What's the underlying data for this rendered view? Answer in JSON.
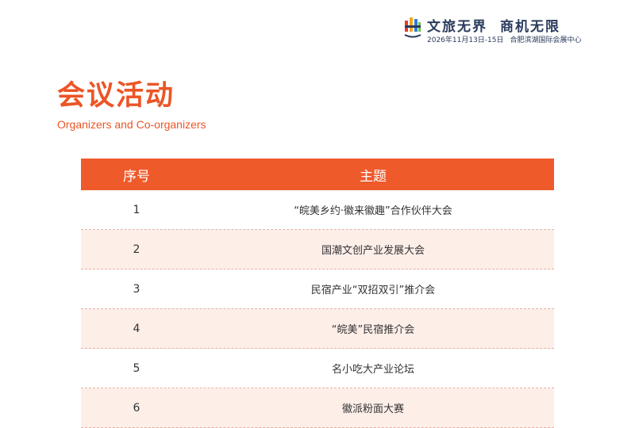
{
  "brand": {
    "slogan_left": "文旅无界",
    "slogan_right": "商机无限",
    "event_dates": "2026年11月13日-15日",
    "event_venue": "合肥滨湖国际会展中心",
    "logo_icon": "exhibition-logo-icon",
    "colors": {
      "accent": "#ef5a2b",
      "text_dark": "#2a3b5c",
      "row_alt": "#fdeee8"
    }
  },
  "page": {
    "title": "会议活动",
    "subtitle": "Organizers and Co-organizers"
  },
  "table": {
    "headers": {
      "no": "序号",
      "topic": "主题"
    },
    "rows": [
      {
        "no": "1",
        "topic": "“皖美乡约·徽来徽趣”合作伙伴大会"
      },
      {
        "no": "2",
        "topic": "国潮文创产业发展大会"
      },
      {
        "no": "3",
        "topic": "民宿产业“双招双引”推介会"
      },
      {
        "no": "4",
        "topic": "“皖美”民宿推介会"
      },
      {
        "no": "5",
        "topic": "名小吃大产业论坛"
      },
      {
        "no": "6",
        "topic": "徽派粉面大赛"
      }
    ]
  }
}
